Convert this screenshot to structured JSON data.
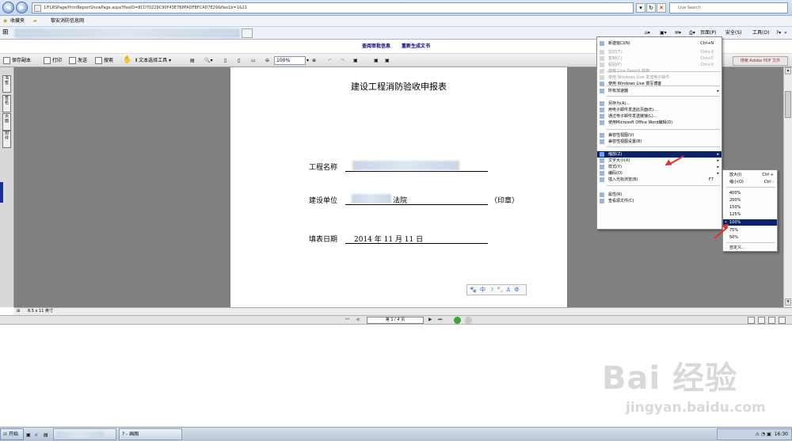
{
  "browser": {
    "address": "1/FLRSPage/PrintReportShowPage.aspx?flexID=8CD70229C90F43E7B8FADFBFCAD7E29&flex1b=1&11",
    "live_search_placeholder": "Live Search",
    "favorites_label": "收藏夹",
    "fav_link": "黎安消防信息网",
    "cmd": {
      "page": "页面(P)",
      "safety": "安全(S)",
      "tools": "工具(O)"
    }
  },
  "page_links": {
    "approval_info": "查阅审批信息",
    "regenerate": "重新生成文书"
  },
  "reader_toolbar": {
    "save_copy": "保存副本",
    "print": "打印",
    "send": "发送",
    "search": "搜索",
    "text_select": "文本选择工具",
    "zoom_value": "100%",
    "search_pdf": "搜索 Adobe PDF 文件"
  },
  "left_tabs": [
    "书签",
    "签名",
    "页面",
    "附件"
  ],
  "document": {
    "title": "建设工程消防验收申报表",
    "project_label": "工程名称",
    "unit_label": "建设单位",
    "unit_value": "法院",
    "seal": "（印章）",
    "date_label": "填表日期",
    "date_value": "2014 年 11 月 11 日"
  },
  "mini_toolbar": [
    "🐾",
    "中",
    "☽",
    "°,",
    "♙",
    "⚙"
  ],
  "status": {
    "page_size": "8.5 x 11 英寸",
    "page_indicator": "第 1 / 4 页"
  },
  "context_menu": {
    "items": [
      {
        "label": "新建窗口(N)",
        "shortcut": "Ctrl+N",
        "disabled": false
      },
      {
        "label": "剪切(T)",
        "shortcut": "Ctrl+X",
        "disabled": true
      },
      {
        "label": "复制(C)",
        "shortcut": "Ctrl+C",
        "disabled": true
      },
      {
        "label": "粘贴(P)",
        "shortcut": "Ctrl+V",
        "disabled": true
      },
      {
        "label": "使用 Live Search 转换",
        "shortcut": "",
        "disabled": true
      },
      {
        "label": "使用 Windows Live 发送电子邮件",
        "shortcut": "",
        "disabled": true
      },
      {
        "label": "使用 Windows Live 撰写博客",
        "shortcut": "",
        "disabled": false
      },
      {
        "label": "所有加速器",
        "shortcut": "",
        "disabled": false,
        "submenu": true
      },
      {
        "label": "另存为(A)...",
        "shortcut": "",
        "disabled": false
      },
      {
        "label": "用电子邮件发送此页面(E)...",
        "shortcut": "",
        "disabled": false
      },
      {
        "label": "通过电子邮件发送链接(L)...",
        "shortcut": "",
        "disabled": false
      },
      {
        "label": "使用Microsoft Office Word编辑(D)",
        "shortcut": "",
        "disabled": false
      },
      {
        "label": "兼容性视图(V)",
        "shortcut": "",
        "disabled": false
      },
      {
        "label": "兼容性视图设置(B)",
        "shortcut": "",
        "disabled": false
      },
      {
        "label": "缩放(Z)",
        "shortcut": "",
        "disabled": false,
        "submenu": true,
        "selected": true
      },
      {
        "label": "文字大小(X)",
        "shortcut": "",
        "disabled": false,
        "submenu": true
      },
      {
        "label": "样式(Y)",
        "shortcut": "",
        "disabled": false,
        "submenu": true
      },
      {
        "label": "编码(O)",
        "shortcut": "",
        "disabled": false,
        "submenu": true
      },
      {
        "label": "插入光标浏览(B)",
        "shortcut": "F7",
        "disabled": false
      },
      {
        "label": "属性(R)",
        "shortcut": "",
        "disabled": false
      },
      {
        "label": "查看源文件(C)",
        "shortcut": "",
        "disabled": false
      }
    ]
  },
  "zoom_submenu": {
    "items": [
      {
        "label": "放大(I)",
        "shortcut": "Ctrl +"
      },
      {
        "label": "缩小(O)",
        "shortcut": "Ctrl -"
      },
      {
        "label": "400%",
        "shortcut": ""
      },
      {
        "label": "200%",
        "shortcut": ""
      },
      {
        "label": "150%",
        "shortcut": ""
      },
      {
        "label": "125%",
        "shortcut": ""
      },
      {
        "label": "100%",
        "shortcut": "",
        "selected": true
      },
      {
        "label": "75%",
        "shortcut": ""
      },
      {
        "label": "50%",
        "shortcut": ""
      },
      {
        "label": "自定义...",
        "shortcut": ""
      }
    ]
  },
  "taskbar": {
    "start": "开始",
    "task_paint": "? - 画图",
    "clock": "16:30"
  },
  "watermark": {
    "logo": "Bai 经验",
    "url": "jingyan.baidu.com"
  },
  "colors": {
    "menu_highlight": "#0a246a",
    "arrow": "#e03030",
    "doc_bg": "#808080"
  }
}
